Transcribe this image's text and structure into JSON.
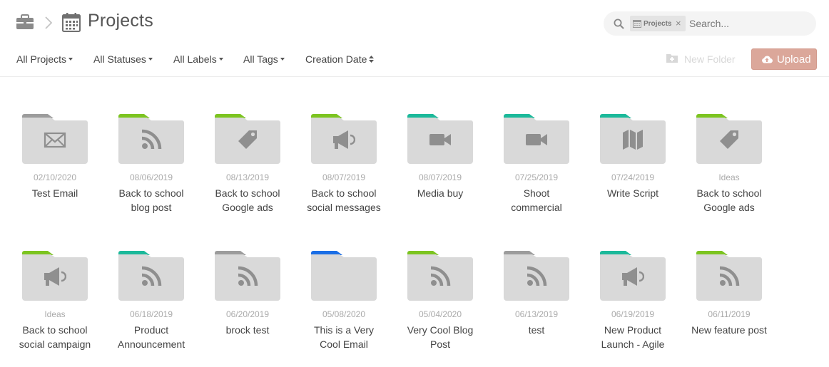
{
  "header": {
    "title": "Projects"
  },
  "search": {
    "chip_label": "Projects",
    "chip_close": "×",
    "placeholder": "Search..."
  },
  "filters": {
    "all_projects": "All Projects",
    "all_statuses": "All Statuses",
    "all_labels": "All Labels",
    "all_tags": "All Tags",
    "creation_date": "Creation Date"
  },
  "actions": {
    "new_folder": "New Folder",
    "upload": "Upload"
  },
  "colors": {
    "green": "#7cc420",
    "teal": "#1bb99a",
    "gray": "#9c9c9c",
    "blue": "#1a6ee6",
    "folder_body": "#d9d9d9",
    "glyph": "#8f8f8f",
    "upload": "#dba79a"
  },
  "items": [
    {
      "date": "02/10/2020",
      "name": "Test Email",
      "tab_color": "gray",
      "icon": "mail-icon"
    },
    {
      "date": "08/06/2019",
      "name": "Back to school blog post",
      "tab_color": "green",
      "icon": "rss-icon"
    },
    {
      "date": "08/13/2019",
      "name": "Back to school Google ads",
      "tab_color": "green",
      "icon": "tag-icon"
    },
    {
      "date": "08/07/2019",
      "name": "Back to school social messages",
      "tab_color": "green",
      "icon": "megaphone-icon"
    },
    {
      "date": "08/07/2019",
      "name": "Media buy",
      "tab_color": "teal",
      "icon": "video-icon"
    },
    {
      "date": "07/25/2019",
      "name": "Shoot commercial",
      "tab_color": "teal",
      "icon": "video-icon"
    },
    {
      "date": "07/24/2019",
      "name": "Write Script",
      "tab_color": "teal",
      "icon": "map-icon"
    },
    {
      "date": "Ideas",
      "name": "Back to school Google ads",
      "tab_color": "green",
      "icon": "tag-icon"
    },
    {
      "date": "Ideas",
      "name": "Back to school social campaign",
      "tab_color": "green",
      "icon": "megaphone-icon"
    },
    {
      "date": "06/18/2019",
      "name": "Product Announcement",
      "tab_color": "teal",
      "icon": "rss-icon"
    },
    {
      "date": "06/20/2019",
      "name": "brock test",
      "tab_color": "gray",
      "icon": "rss-icon"
    },
    {
      "date": "05/08/2020",
      "name": "This is a Very Cool Email",
      "tab_color": "blue",
      "icon": ""
    },
    {
      "date": "05/04/2020",
      "name": "Very Cool Blog Post",
      "tab_color": "green",
      "icon": "rss-icon"
    },
    {
      "date": "06/13/2019",
      "name": "test",
      "tab_color": "gray",
      "icon": "rss-icon"
    },
    {
      "date": "06/19/2019",
      "name": "New Product Launch - Agile",
      "tab_color": "teal",
      "icon": "megaphone-icon"
    },
    {
      "date": "06/11/2019",
      "name": "New feature post",
      "tab_color": "green",
      "icon": "rss-icon"
    }
  ]
}
